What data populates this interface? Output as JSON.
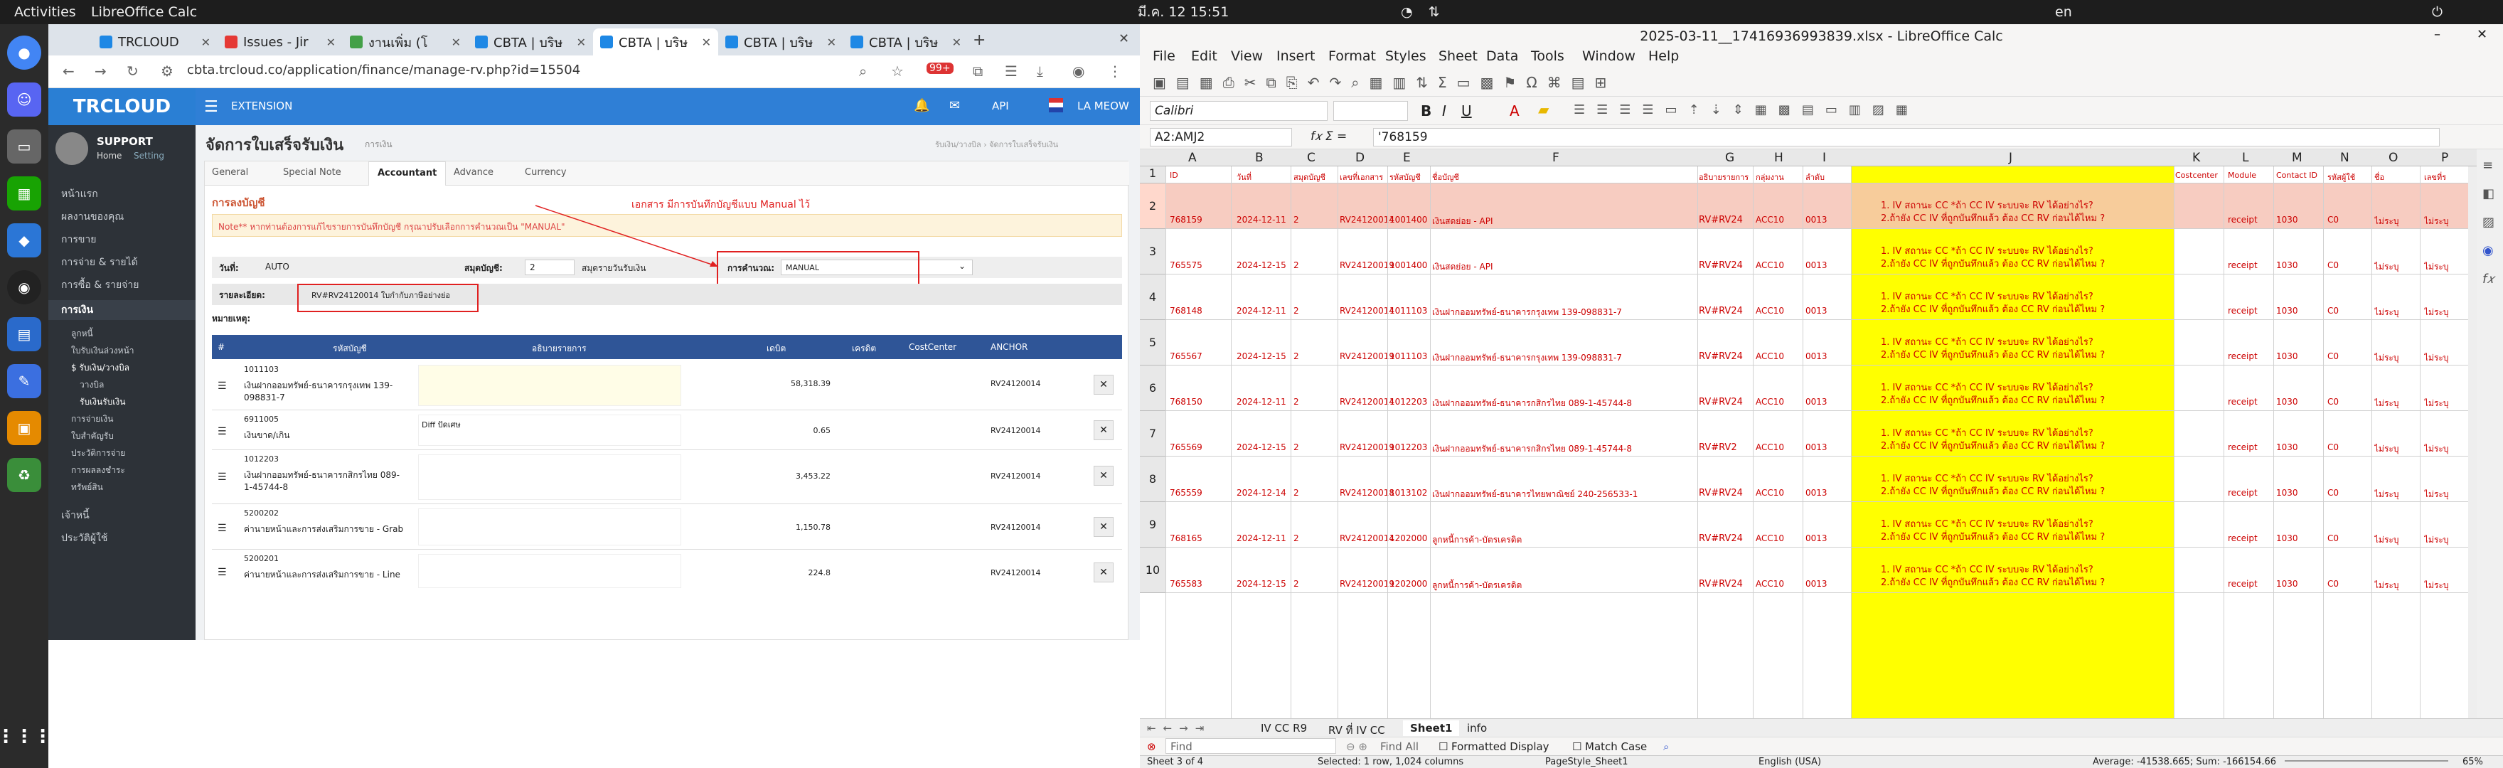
{
  "topbar": {
    "activities": "Activities",
    "app": "LibreOffice Calc",
    "clock": "มี.ค. 12  15:51",
    "lang": "en"
  },
  "browser": {
    "tabs": [
      {
        "label": "TRCLOUD",
        "color": "#1e88e5"
      },
      {
        "label": "Issues - Jir",
        "color": "#e53935"
      },
      {
        "label": "งานเพิ่ม (โ",
        "color": "#43a047"
      },
      {
        "label": "CBTA | บริษ",
        "color": "#1e88e5"
      },
      {
        "label": "CBTA | บริษ",
        "color": "#1e88e5"
      },
      {
        "label": "CBTA | บริษ",
        "color": "#1e88e5"
      },
      {
        "label": "CBTA | บริษ",
        "color": "#1e88e5"
      }
    ],
    "url": "cbta.trcloud.co/application/finance/manage-rv.php?id=15504"
  },
  "app": {
    "logo": "TRCLOUD",
    "support": "SUPPORT",
    "home": "Home",
    "setting": "Setting",
    "menu": [
      "หน้าแรก",
      "ผลงานของคุณ",
      "การขาย",
      "การจ่าย & รายได้",
      "การซื้อ & รายจ่าย",
      "การเงิน",
      "ลูกหนี้",
      "ใบรับเงินล่วงหน้า",
      "$ รับเงิน/วางบิล",
      "วางบิล",
      "รับเงินรับเงิน",
      "การจ่ายเงิน",
      "ใบสำคัญรับ",
      "ประวัติการจ่าย",
      "การผลลงชำระ",
      "ทรัพย์สิน",
      "เจ้าหนี้",
      "ประวัติผู้ใช้"
    ],
    "header_extension": "EXTENSION",
    "header_api": "API",
    "header_user": "LA MEOW",
    "page_title": "จัดการใบเสร็จรับเงิน",
    "page_sub": "การเงิน",
    "breadcrumb": "รับเงิน/วางบิล  ›  จัดการใบเสร็จรับเงิน",
    "tabs": [
      "General",
      "Special Note",
      "Accountant",
      "Advance",
      "Currency"
    ],
    "section_title": "การลงบัญชี",
    "note": "Note** หากท่านต้องการแก้ไขรายการบันทึกบัญชี กรุณาปรับเลือกการคำนวณเป็น \"MANUAL\"",
    "annotation": "เอกสาร มีการบันทึกบัญชีแบบ Manual ไว้",
    "date_label": "วันที่:",
    "date_value": "AUTO",
    "book_label": "สมุดบัญชี:",
    "book_value": "2",
    "book_name": "สมุดรายวันรับเงิน",
    "calc_label": "การคำนวณ:",
    "calc_value": "MANUAL",
    "detail_label": "รายละเอียด:",
    "detail_value": "RV#RV24120014  ใบกำกับภาษีอย่างย่อ",
    "remark_label": "หมายเหตุ:",
    "table_head": [
      "#",
      "รหัสบัญชี",
      "อธิบายรายการ",
      "เดบิต",
      "เครดิต",
      "CostCenter",
      "ANCHOR"
    ],
    "rows": [
      {
        "code": "1011103",
        "name": "เงินฝากออมทรัพย์-ธนาคารกรุงเทพ 139-098831-7",
        "desc": "",
        "debit": "58,318.39",
        "credit": "",
        "anchor": "RV24120014"
      },
      {
        "code": "6911005",
        "name": "เงินขาด/เกิน",
        "desc": "Diff ปัดเศษ",
        "debit": "0.65",
        "credit": "",
        "anchor": "RV24120014"
      },
      {
        "code": "1012203",
        "name": "เงินฝากออมทรัพย์-ธนาคารกสิกรไทย 089-1-45744-8",
        "desc": "",
        "debit": "3,453.22",
        "credit": "",
        "anchor": "RV24120014"
      },
      {
        "code": "5200202",
        "name": "ค่านายหน้าและการส่งเสริมการขาย - Grab",
        "desc": "",
        "debit": "1,150.78",
        "credit": "",
        "anchor": "RV24120014"
      },
      {
        "code": "5200201",
        "name": "ค่านายหน้าและการส่งเสริมการขาย - Line",
        "desc": "",
        "debit": "224.8",
        "credit": "",
        "anchor": "RV24120014"
      }
    ]
  },
  "calc": {
    "title": "2025-03-11__17416936993839.xlsx - LibreOffice Calc",
    "menu": [
      "File",
      "Edit",
      "View",
      "Insert",
      "Format",
      "Styles",
      "Sheet",
      "Data",
      "Tools",
      "Window",
      "Help"
    ],
    "font": "Calibri",
    "namebox": "A2:AMJ2",
    "formula": "'768159",
    "columns": [
      "A",
      "B",
      "C",
      "D",
      "E",
      "F",
      "G",
      "H",
      "I",
      "J",
      "K",
      "L",
      "M",
      "N",
      "O",
      "P"
    ],
    "headers": [
      "ID",
      "วันที่",
      "สมุดบัญชี",
      "เลขที่เอกสาร",
      "รหัสบัญชี",
      "ชื่อบัญชี",
      "อธิบายรายการ",
      "กลุ่มงาน",
      "ลำดับ",
      "",
      "Costcenter",
      "Module",
      "Contact ID",
      "รหัสผู้ใช้",
      "ชื่อ",
      "เลขที่ร"
    ],
    "note_line1": "1. IV สถานะ CC *ถ้า CC IV ระบบจะ RV ได้อย่างไร?",
    "note_line2": "2.ถ้ายัง CC IV ที่ถูกบันทึกแล้ว ต้อง CC RV ก่อนได้ไหม ?",
    "rows": [
      {
        "n": "2",
        "id": "768159",
        "date": "2024-12-11",
        "book": "2",
        "doc": "RV24120014",
        "acc": "1001400",
        "name": "เงินสดย่อย - API",
        "g": "RV#RV24",
        "h": "ACC10",
        "i": "0013",
        "mod": "receipt",
        "cid": "1030",
        "uid": "C0",
        "nm": "ไม่ระบุ"
      },
      {
        "n": "3",
        "id": "765575",
        "date": "2024-12-15",
        "book": "2",
        "doc": "RV24120019",
        "acc": "1001400",
        "name": "เงินสดย่อย - API",
        "g": "RV#RV24",
        "h": "ACC10",
        "i": "0013",
        "mod": "receipt",
        "cid": "1030",
        "uid": "C0",
        "nm": "ไม่ระบุ"
      },
      {
        "n": "4",
        "id": "768148",
        "date": "2024-12-11",
        "book": "2",
        "doc": "RV24120014",
        "acc": "1011103",
        "name": "เงินฝากออมทรัพย์-ธนาคารกรุงเทพ 139-098831-7",
        "g": "RV#RV24",
        "h": "ACC10",
        "i": "0013",
        "mod": "receipt",
        "cid": "1030",
        "uid": "C0",
        "nm": "ไม่ระบุ"
      },
      {
        "n": "5",
        "id": "765567",
        "date": "2024-12-15",
        "book": "2",
        "doc": "RV24120019",
        "acc": "1011103",
        "name": "เงินฝากออมทรัพย์-ธนาคารกรุงเทพ 139-098831-7",
        "g": "RV#RV24",
        "h": "ACC10",
        "i": "0013",
        "mod": "receipt",
        "cid": "1030",
        "uid": "C0",
        "nm": "ไม่ระบุ"
      },
      {
        "n": "6",
        "id": "768150",
        "date": "2024-12-11",
        "book": "2",
        "doc": "RV24120014",
        "acc": "1012203",
        "name": "เงินฝากออมทรัพย์-ธนาคารกสิกรไทย 089-1-45744-8",
        "g": "RV#RV24",
        "h": "ACC10",
        "i": "0013",
        "mod": "receipt",
        "cid": "1030",
        "uid": "C0",
        "nm": "ไม่ระบุ"
      },
      {
        "n": "7",
        "id": "765569",
        "date": "2024-12-15",
        "book": "2",
        "doc": "RV24120019",
        "acc": "1012203",
        "name": "เงินฝากออมทรัพย์-ธนาคารกสิกรไทย 089-1-45744-8",
        "g": "RV#RV2",
        "h": "ACC10",
        "i": "0013",
        "mod": "receipt",
        "cid": "1030",
        "uid": "C0",
        "nm": "ไม่ระบุ"
      },
      {
        "n": "8",
        "id": "765559",
        "date": "2024-12-14",
        "book": "2",
        "doc": "RV24120018",
        "acc": "1013102",
        "name": "เงินฝากออมทรัพย์-ธนาคารไทยพาณิชย์ 240-256533-1",
        "g": "RV#RV24",
        "h": "ACC10",
        "i": "0013",
        "mod": "receipt",
        "cid": "1030",
        "uid": "C0",
        "nm": "ไม่ระบุ"
      },
      {
        "n": "9",
        "id": "768165",
        "date": "2024-12-11",
        "book": "2",
        "doc": "RV24120014",
        "acc": "1202000",
        "name": "ลูกหนี้การค้า-บัตรเครดิต",
        "g": "RV#RV24",
        "h": "ACC10",
        "i": "0013",
        "mod": "receipt",
        "cid": "1030",
        "uid": "C0",
        "nm": "ไม่ระบุ"
      },
      {
        "n": "10",
        "id": "765583",
        "date": "2024-12-15",
        "book": "2",
        "doc": "RV24120019",
        "acc": "1202000",
        "name": "ลูกหนี้การค้า-บัตรเครดิต",
        "g": "RV#RV24",
        "h": "ACC10",
        "i": "0013",
        "mod": "receipt",
        "cid": "1030",
        "uid": "C0",
        "nm": "ไม่ระบุ"
      }
    ],
    "sheets": [
      "IV CC R9",
      "RV ที่ IV CC",
      "Sheet1",
      "info"
    ],
    "find_placeholder": "Find",
    "find_all": "Find All",
    "formatted": "Formatted Display",
    "match_case": "Match Case",
    "status": {
      "sheet": "Sheet 3 of 4",
      "selected": "Selected: 1 row, 1,024 columns",
      "style": "PageStyle_Sheet1",
      "lang": "English (USA)",
      "sum": "Average: -41538.665; Sum: -166154.66",
      "zoom": "65%"
    },
    "colors": {
      "yellow": "#ffff00",
      "selrow": "#f6c3b6",
      "text": "#cc0000"
    }
  }
}
